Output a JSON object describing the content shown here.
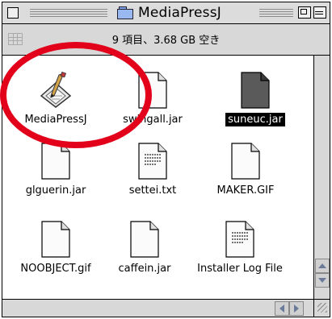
{
  "window": {
    "title": "MediaPressJ",
    "title_icon": "folder-icon"
  },
  "info": {
    "status": "9 項目、3.68 GB 空き"
  },
  "items": [
    {
      "label": "MediaPressJ",
      "icon": "application-icon",
      "selected": false
    },
    {
      "label": "swingall.jar",
      "icon": "document-icon",
      "selected": false
    },
    {
      "label": "suneuc.jar",
      "icon": "document-icon",
      "selected": true
    },
    {
      "label": "glguerin.jar",
      "icon": "document-icon",
      "selected": false
    },
    {
      "label": "settei.txt",
      "icon": "text-document-icon",
      "selected": false
    },
    {
      "label": "MAKER.GIF",
      "icon": "document-icon",
      "selected": false
    },
    {
      "label": "NOOBJECT.gif",
      "icon": "document-icon",
      "selected": false
    },
    {
      "label": "caffein.jar",
      "icon": "document-icon",
      "selected": false
    },
    {
      "label": "Installer Log File",
      "icon": "text-document-icon",
      "selected": false
    }
  ],
  "colors": {
    "annotation": "#e3001b",
    "selection": "#000000"
  }
}
